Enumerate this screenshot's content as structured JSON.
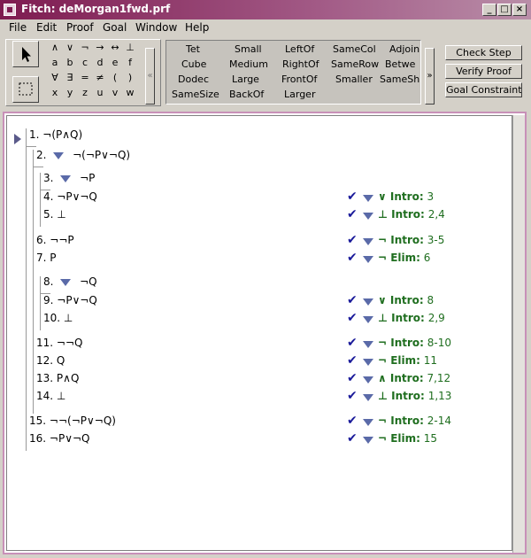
{
  "window": {
    "title": "Fitch: deMorgan1fwd.prf"
  },
  "menu": [
    "File",
    "Edit",
    "Proof",
    "Goal",
    "Window",
    "Help"
  ],
  "symbols": [
    [
      "∧",
      "∨",
      "¬",
      "→",
      "↔",
      "⊥"
    ],
    [
      "a",
      "b",
      "c",
      "d",
      "e",
      "f"
    ],
    [
      "∀",
      "∃",
      "=",
      "≠",
      "(",
      ")"
    ],
    [
      "x",
      "y",
      "z",
      "u",
      "v",
      "w"
    ]
  ],
  "predicates": [
    [
      "Tet",
      "Small",
      "LeftOf",
      "SameCol",
      "Adjoin"
    ],
    [
      "Cube",
      "Medium",
      "RightOf",
      "SameRow",
      "Betwe"
    ],
    [
      "Dodec",
      "Large",
      "FrontOf",
      "Smaller",
      "SameSh"
    ],
    [
      "SameSize",
      "BackOf",
      "Larger",
      "",
      ""
    ]
  ],
  "scroll_left": "«",
  "scroll_right": "»",
  "buttons": {
    "check_step": "Check Step",
    "verify_proof": "Verify Proof",
    "goal_constraints": "Goal Constraints"
  },
  "steps": [
    {
      "num": "1.",
      "text": "¬(P∧Q)",
      "drop": false,
      "rule": "",
      "support": ""
    },
    {
      "num": "2.",
      "text": "¬(¬P∨¬Q)",
      "drop": true,
      "rule": "",
      "support": ""
    },
    {
      "num": "3.",
      "text": "¬P",
      "drop": true,
      "rule": "",
      "support": ""
    },
    {
      "num": "4.",
      "text": "¬P∨¬Q",
      "drop": false,
      "rule": "∨ Intro:",
      "support": "3"
    },
    {
      "num": "5.",
      "text": "⊥",
      "drop": false,
      "rule": "⊥ Intro:",
      "support": "2,4"
    },
    {
      "num": "6.",
      "text": "¬¬P",
      "drop": false,
      "rule": "¬ Intro:",
      "support": "3-5"
    },
    {
      "num": "7.",
      "text": "P",
      "drop": false,
      "rule": "¬ Elim:",
      "support": "6"
    },
    {
      "num": "8.",
      "text": "¬Q",
      "drop": true,
      "rule": "",
      "support": ""
    },
    {
      "num": "9.",
      "text": "¬P∨¬Q",
      "drop": false,
      "rule": "∨ Intro:",
      "support": "8"
    },
    {
      "num": "10.",
      "text": "⊥",
      "drop": false,
      "rule": "⊥ Intro:",
      "support": "2,9"
    },
    {
      "num": "11.",
      "text": "¬¬Q",
      "drop": false,
      "rule": "¬ Intro:",
      "support": "8-10"
    },
    {
      "num": "12.",
      "text": "Q",
      "drop": false,
      "rule": "¬ Elim:",
      "support": "11"
    },
    {
      "num": "13.",
      "text": "P∧Q",
      "drop": false,
      "rule": "∧ Intro:",
      "support": "7,12"
    },
    {
      "num": "14.",
      "text": "⊥",
      "drop": false,
      "rule": "⊥ Intro:",
      "support": "1,13"
    },
    {
      "num": "15.",
      "text": "¬¬(¬P∨¬Q)",
      "drop": false,
      "rule": "¬ Intro:",
      "support": "2-14"
    },
    {
      "num": "16.",
      "text": "¬P∨¬Q",
      "drop": false,
      "rule": "¬ Elim:",
      "support": "15"
    }
  ],
  "icons": {
    "check": "✔",
    "cursor": "arrow-cursor-icon",
    "select": "marquee-select-icon"
  },
  "colors": {
    "titlebar": "#7e1b50",
    "rule_text": "#1f6e1f",
    "check": "#1a1a9a",
    "frame": "#c890b8"
  }
}
